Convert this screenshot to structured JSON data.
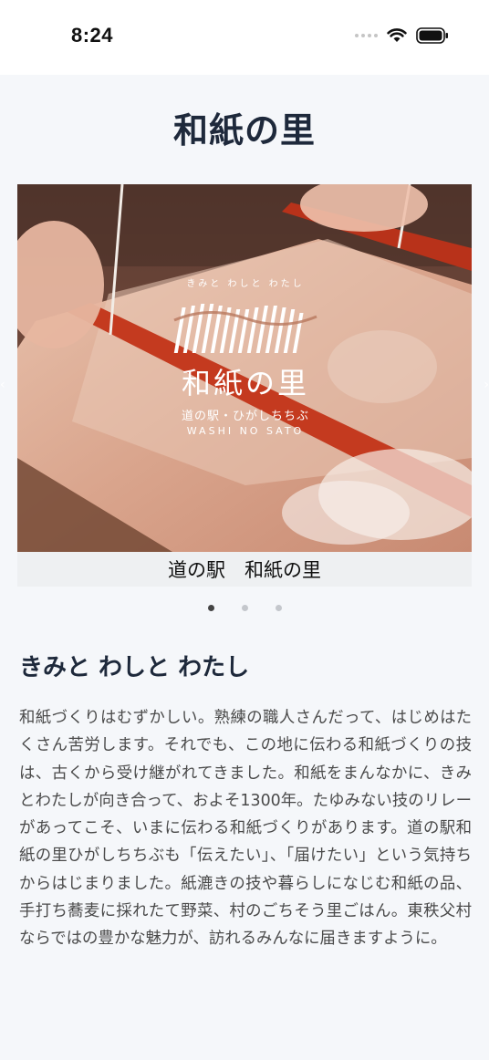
{
  "status_bar": {
    "time": "8:24"
  },
  "header": {
    "title": "和紙の里"
  },
  "carousel": {
    "caption": "道の駅　和紙の里",
    "slide_count": 3,
    "active_index": 0,
    "logo": {
      "tagline": "きみと わしと わたし",
      "title": "和紙の里",
      "subtitle": "道の駅・ひがしちちぶ",
      "roman": "WASHI NO SATO"
    }
  },
  "section": {
    "heading": "きみと わしと わたし",
    "body": "和紙づくりはむずかしい。熟練の職人さんだって、はじめはたくさん苦労します。それでも、この地に伝わる和紙づくりの技は、古くから受け継がれてきました。和紙をまんなかに、きみとわたしが向き合って、およそ1300年。たゆみない技のリレーがあってこそ、いまに伝わる和紙づくりがあります。道の駅和紙の里ひがしちちぶも「伝えたい」、「届けたい」という気持ちからはじまりました。紙漉きの技や暮らしになじむ和紙の品、手打ち蕎麦に採れたて野菜、村のごちそう里ごはん。東秩父村ならではの豊かな魅力が、訪れるみんなに届きますように。"
  },
  "colors": {
    "background": "#f5f7fa",
    "title": "#1e293b",
    "body_text": "#4a4a4a",
    "frame_red": "#c43a1f"
  }
}
